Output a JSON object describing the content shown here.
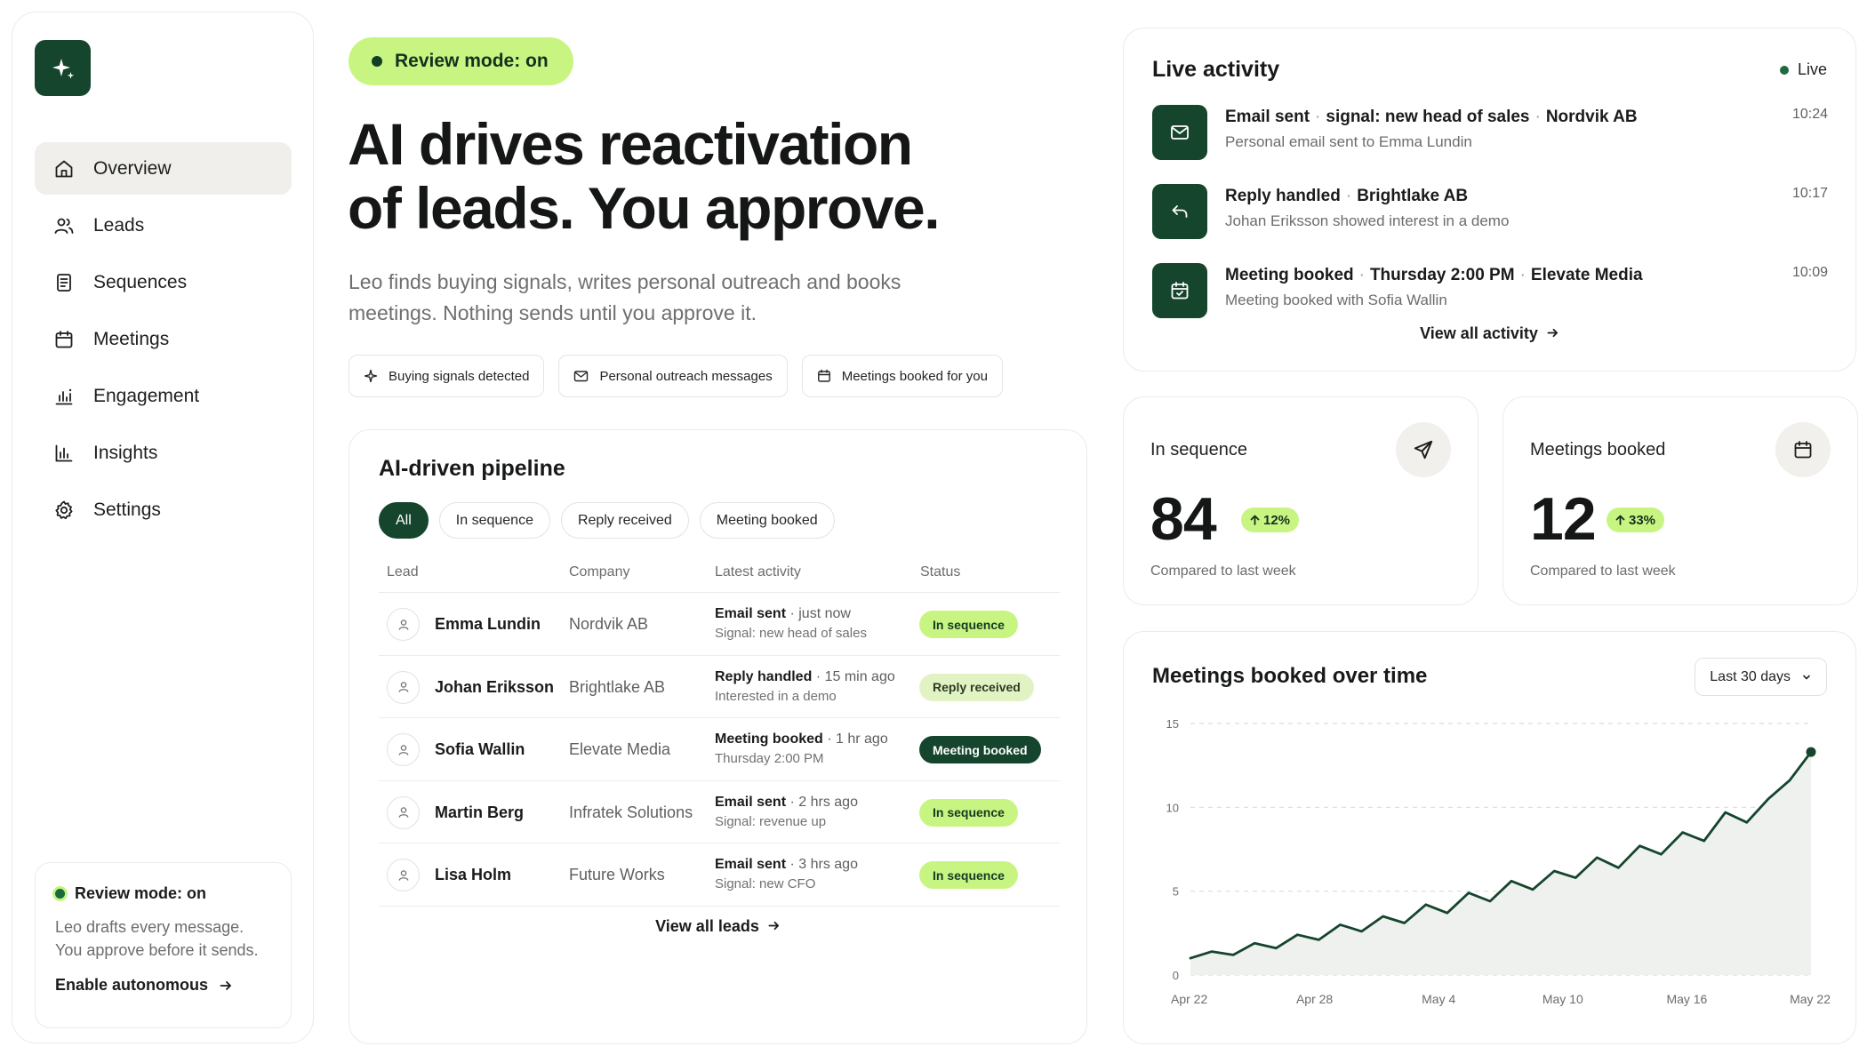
{
  "sidebar": {
    "logo_icon": "sparkle-icon",
    "nav": [
      {
        "label": "Overview",
        "icon": "home-icon",
        "active": true
      },
      {
        "label": "Leads",
        "icon": "users-icon"
      },
      {
        "label": "Sequences",
        "icon": "document-icon"
      },
      {
        "label": "Meetings",
        "icon": "calendar-icon"
      },
      {
        "label": "Engagement",
        "icon": "engagement-chart-icon"
      },
      {
        "label": "Insights",
        "icon": "bar-chart-icon"
      },
      {
        "label": "Settings",
        "icon": "gear-icon"
      }
    ],
    "review_card": {
      "title": "Review mode: on",
      "description": "Leo drafts every message. You approve before it sends.",
      "link": "Enable autonomous"
    }
  },
  "hero": {
    "pill": "Review mode: on",
    "headline_line1": "AI drives reactivation",
    "headline_line2": "of leads. You approve.",
    "subtitle": "Leo finds buying signals, writes personal outreach and books meetings. Nothing sends until you approve it.",
    "chips": [
      "Buying signals detected",
      "Personal outreach messages",
      "Meetings booked for you"
    ]
  },
  "pipeline": {
    "title": "AI-driven pipeline",
    "tabs": [
      "All",
      "In sequence",
      "Reply received",
      "Meeting booked"
    ],
    "columns": [
      "Lead",
      "Company",
      "Latest activity",
      "Status"
    ],
    "rows": [
      {
        "lead": "Emma Lundin",
        "company": "Nordvik AB",
        "activity": "Email sent",
        "when": "just now",
        "detail": "Signal: new head of sales",
        "status": "In sequence",
        "kind": "seq"
      },
      {
        "lead": "Johan Eriksson",
        "company": "Brightlake AB",
        "activity": "Reply handled",
        "when": "15 min ago",
        "detail": "Interested in a demo",
        "status": "Reply received",
        "kind": "rep"
      },
      {
        "lead": "Sofia Wallin",
        "company": "Elevate Media",
        "activity": "Meeting booked",
        "when": "1 hr ago",
        "detail": "Thursday 2:00 PM",
        "status": "Meeting booked",
        "kind": "meet"
      },
      {
        "lead": "Martin Berg",
        "company": "Infratek Solutions",
        "activity": "Email sent",
        "when": "2 hrs ago",
        "detail": "Signal: revenue up",
        "status": "In sequence",
        "kind": "seq"
      },
      {
        "lead": "Lisa Holm",
        "company": "Future Works",
        "activity": "Email sent",
        "when": "3 hrs ago",
        "detail": "Signal: new CFO",
        "status": "In sequence",
        "kind": "seq"
      }
    ],
    "view_all": "View all leads"
  },
  "live": {
    "title": "Live activity",
    "badge": "Live",
    "items": [
      {
        "parts": [
          "Email sent",
          "signal: new head of sales",
          "Nordvik AB"
        ],
        "desc": "Personal email sent to Emma Lundin",
        "time": "10:24",
        "icon": "mail-icon"
      },
      {
        "parts": [
          "Reply handled",
          "Brightlake AB"
        ],
        "desc": "Johan Eriksson showed interest in a demo",
        "time": "10:17",
        "icon": "reply-icon"
      },
      {
        "parts": [
          "Meeting booked",
          "Thursday 2:00 PM",
          "Elevate Media"
        ],
        "desc": "Meeting booked with Sofia Wallin",
        "time": "10:09",
        "icon": "calendar-check-icon"
      }
    ],
    "view_all": "View all activity"
  },
  "stats": [
    {
      "label": "In sequence",
      "value": "84",
      "delta": "12%",
      "compare": "Compared to last week",
      "icon": "send-icon"
    },
    {
      "label": "Meetings booked",
      "value": "12",
      "delta": "33%",
      "compare": "Compared to last week",
      "icon": "calendar-icon"
    }
  ],
  "chart": {
    "title": "Meetings booked over time",
    "range_select": "Last 30 days"
  },
  "chart_data": {
    "type": "area",
    "title": "Meetings booked over time",
    "x_ticks": [
      "Apr 22",
      "Apr 28",
      "May 4",
      "May 10",
      "May 16",
      "May 22"
    ],
    "y_ticks": [
      0,
      5,
      10,
      15
    ],
    "ylim": [
      0,
      15
    ],
    "grid": true,
    "series": [
      {
        "values": [
          1.0,
          1.4,
          1.2,
          1.9,
          1.6,
          2.4,
          2.1,
          3.0,
          2.6,
          3.5,
          3.1,
          4.2,
          3.7,
          4.9,
          4.4,
          5.6,
          5.1,
          6.2,
          5.8,
          7.0,
          6.4,
          7.7,
          7.2,
          8.5,
          8.0,
          9.7,
          9.1,
          10.5,
          11.6,
          13.3
        ],
        "color": "#15452d",
        "fill": "#eef1ed"
      }
    ]
  },
  "colors": {
    "brand_dark": "#15452d",
    "accent_lime": "#c8f582",
    "accent_light": "#e2f3c3"
  }
}
